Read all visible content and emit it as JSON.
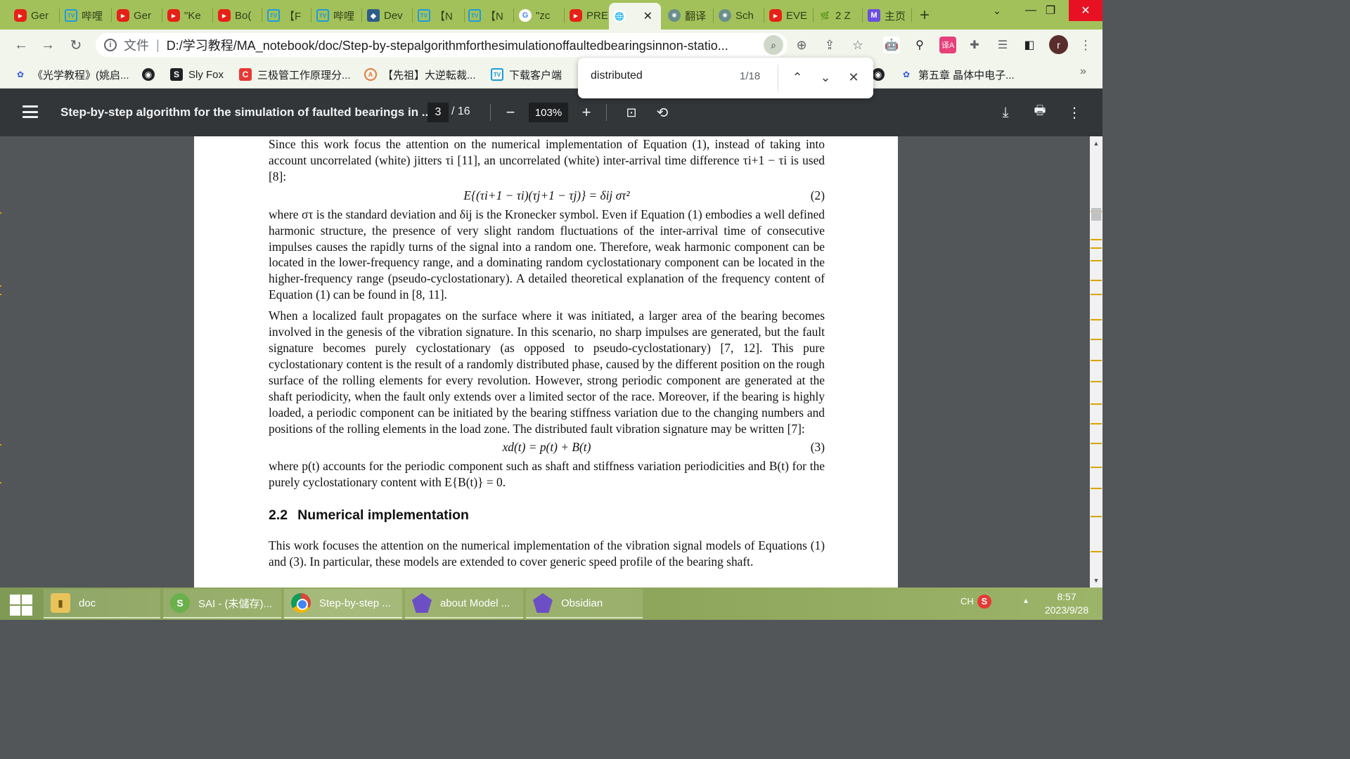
{
  "browser": {
    "tabs": [
      {
        "icon": "youtube-icon",
        "label": "Ger"
      },
      {
        "icon": "bilibili-icon",
        "label": "哔哩"
      },
      {
        "icon": "youtube-icon",
        "label": "Ger"
      },
      {
        "icon": "youtube-icon",
        "label": "\"Ke"
      },
      {
        "icon": "youtube-icon",
        "label": "Bo("
      },
      {
        "icon": "bilibili-icon",
        "label": "【F"
      },
      {
        "icon": "bilibili-icon",
        "label": "哔哩"
      },
      {
        "icon": "obsidian-icon",
        "label": "Dev"
      },
      {
        "icon": "bilibili-icon",
        "label": "【N"
      },
      {
        "icon": "bilibili-icon",
        "label": "【N"
      },
      {
        "icon": "google-icon",
        "label": "\"zc"
      },
      {
        "icon": "youtube-icon",
        "label": "PRE"
      },
      {
        "icon": "globe-icon",
        "label": "",
        "active": true
      },
      {
        "icon": "chatgpt-icon",
        "label": "翻译"
      },
      {
        "icon": "chatgpt-icon",
        "label": "Sch"
      },
      {
        "icon": "youtube-icon",
        "label": "EVE"
      },
      {
        "icon": "leaf-icon",
        "label": "2 Z"
      },
      {
        "icon": "mastodon-icon",
        "label": "主页"
      }
    ],
    "close_tab_glyph": "✕",
    "new_tab_glyph": "+",
    "omnibox": {
      "scheme_label": "文件",
      "url": "D:/学习教程/MA_notebook/doc/Step-by-stepalgorithmforthesimulationoffaultedbearingsinnon-statio..."
    },
    "bookmarks": [
      {
        "icon": "baidu-icon",
        "label": "《光学教程》(姚启..."
      },
      {
        "icon": "globe-icon",
        "label": ""
      },
      {
        "icon": "slyfox-icon",
        "label": "Sly Fox"
      },
      {
        "icon": "c-icon",
        "label": "三极管工作原理分..."
      },
      {
        "icon": "acfun-icon",
        "label": "【先祖】大逆転裁..."
      },
      {
        "icon": "bilibili-icon",
        "label": "下载客户端"
      },
      {
        "icon": "globe-icon",
        "label": ""
      },
      {
        "icon": "baidu-icon",
        "label": "第五章 晶体中电子..."
      }
    ],
    "bookmarks_more": "»",
    "find": {
      "query": "distributed",
      "count": "1/18"
    },
    "profile_initial": "r"
  },
  "pdf": {
    "title": "Step-by-step algorithm for the simulation of faulted bearings in ...",
    "page_current": "3",
    "page_total": "/ 16",
    "zoom": "103%",
    "content": {
      "p1": "Since this work focus the attention on the numerical implementation of Equation (1), instead of taking into account uncorrelated (white) jitters τi [11], an uncorrelated (white) inter-arrival time difference τi+1 − τi is used [8]:",
      "eq2": "E{(τi+1 − τi)(τj+1 − τj)} = δij στ²",
      "eq2_num": "(2)",
      "p2": "where στ is the standard deviation and δij is the Kronecker symbol. Even if Equation (1) embodies a well defined harmonic structure, the presence of very slight random fluctuations of the inter-arrival time of consecutive impulses causes the rapidly turns of the signal into a random one. Therefore, weak harmonic component can be located in the lower-frequency range, and a dominating random cyclostationary component can be located in the higher-frequency range (pseudo-cyclostationary). A detailed theoretical explanation of the frequency content of Equation (1) can be found in [8, 11].",
      "p3": "When a localized fault propagates on the surface where it was initiated, a larger area of the bearing becomes involved in the genesis of the vibration signature. In this scenario, no sharp impulses are generated, but the fault signature becomes purely cyclostationary (as opposed to pseudo-cyclostationary) [7, 12]. This pure cyclostationary content is the result of a randomly distributed phase, caused by the different position on the rough surface of the rolling elements for every revolution. However, strong periodic component are generated at the shaft periodicity, when the fault only extends over a limited sector of the race. Moreover, if the bearing is highly loaded, a periodic component can be initiated by the bearing stiffness variation due to the changing numbers and positions of the rolling elements in the load zone. The distributed fault vibration signature may be written [7]:",
      "eq3": "xd(t) = p(t) + B(t)",
      "eq3_num": "(3)",
      "p4": "where p(t) accounts for the periodic component such as shaft and stiffness variation periodicities and B(t) for the purely cyclostationary content with E{B(t)} = 0.",
      "h_num": "2.2",
      "h_text": "Numerical implementation",
      "p5": "This work focuses the attention on the numerical implementation of the vibration signal models of Equations (1) and (3). In particular, these models are extended to cover generic speed profile of the bearing shaft."
    }
  },
  "taskbar": {
    "items": [
      {
        "icon": "folder-icon",
        "label": "doc"
      },
      {
        "icon": "sai-icon",
        "label": "SAI - (未儲存)..."
      },
      {
        "icon": "chrome-icon",
        "label": "Step-by-step ..."
      },
      {
        "icon": "obsidian-icon",
        "label": "about Model ..."
      },
      {
        "icon": "obsidian-icon",
        "label": "Obsidian"
      }
    ],
    "ime": "CH",
    "time": "8:57",
    "date": "2023/9/28"
  }
}
